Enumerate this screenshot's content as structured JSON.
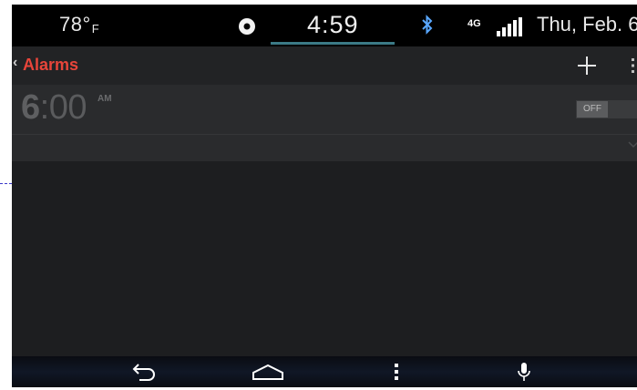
{
  "status_bar": {
    "temperature": "78°",
    "temperature_unit": "F",
    "clock": "4:59",
    "date": "Thu, Feb. 6",
    "network_label": "4G",
    "accent_color": "#3b7a86",
    "icons": [
      "disc-icon",
      "bluetooth-icon",
      "signal-4g-icon"
    ]
  },
  "action_bar": {
    "title": "Alarms",
    "back_glyph": "‹",
    "title_color": "#e8453a",
    "icons": [
      "add-icon",
      "overflow-menu-icon"
    ]
  },
  "alarm": {
    "hour": "6",
    "separator_minutes": ":00",
    "ampm": "AM",
    "toggle_label": "OFF",
    "enabled": false
  },
  "nav_bar": {
    "icons": [
      "back-icon",
      "home-icon",
      "menu-icon",
      "microphone-icon"
    ]
  }
}
